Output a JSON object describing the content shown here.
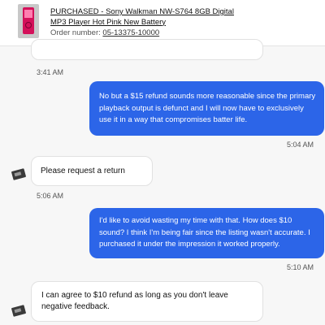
{
  "order": {
    "product_title": "PURCHASED - Sony Walkman NW-S764 8GB Digital MP3 Player Hot Pink New Battery",
    "order_label": "Order number: ",
    "order_number": "05-13375-10000"
  },
  "messages": [
    {
      "time": "3:41 AM"
    },
    {
      "text": "No but a $15 refund sounds more reasonable since the primary playback output is defunct and I will now have to exclusively use it in a way that compromises batter life.",
      "time": "5:04 AM"
    },
    {
      "text": "Please request a return",
      "time": "5:06 AM"
    },
    {
      "text": "I'd like to avoid wasting my time with that. How does $10 sound? I think I'm being fair since the listing wasn't accurate. I purchased it under the impression it worked properly.",
      "time": "5:10 AM"
    },
    {
      "text": "I can agree to $10 refund as long as you don't leave negative feedback."
    }
  ],
  "colors": {
    "outgoing_bubble": "#2c65e8",
    "incoming_bubble": "#ffffff",
    "background": "#f7f7f7"
  }
}
